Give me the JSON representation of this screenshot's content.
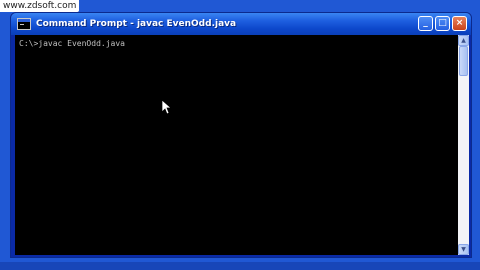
{
  "watermark": {
    "text": "www.zdsoft.com"
  },
  "window": {
    "title": "Command Prompt - javac  EvenOdd.java",
    "buttons": {
      "minimize": "_",
      "maximize": "□",
      "close": "×"
    }
  },
  "console": {
    "lines": [
      "C:\\>javac EvenOdd.java"
    ]
  },
  "scrollbar": {
    "up_arrow": "▲",
    "down_arrow": "▼"
  },
  "icons": {
    "app": "cmd-icon",
    "cursor": "mouse-pointer-icon"
  }
}
